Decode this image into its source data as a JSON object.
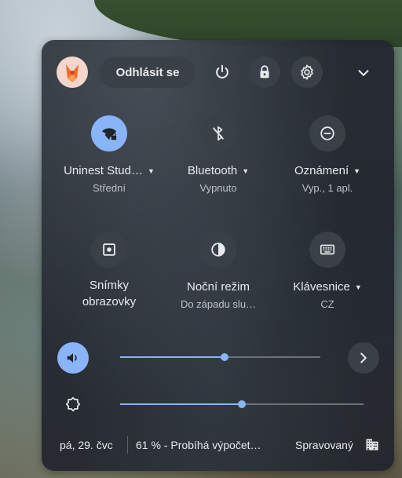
{
  "header": {
    "signout_label": "Odhlásit se"
  },
  "tiles": [
    {
      "label": "Uninest Stud…",
      "sub": "Střední"
    },
    {
      "label": "Bluetooth",
      "sub": "Vypnuto"
    },
    {
      "label": "Oznámení",
      "sub": "Vyp., 1 apl."
    },
    {
      "label_line1": "Snímky",
      "label_line2": "obrazovky"
    },
    {
      "label": "Noční režim",
      "sub": "Do západu slu…"
    },
    {
      "label": "Klávesnice",
      "sub": "CZ"
    }
  ],
  "sliders": {
    "volume_level": 0.52,
    "brightness_level": 0.5
  },
  "footer": {
    "date": "pá, 29. čvc",
    "battery": "61 % - Probíhá výpočet…",
    "managed": "Spravovaný"
  },
  "colors": {
    "accent": "#8ab4f8",
    "panel": "#21262d",
    "button": "#3a4047"
  }
}
